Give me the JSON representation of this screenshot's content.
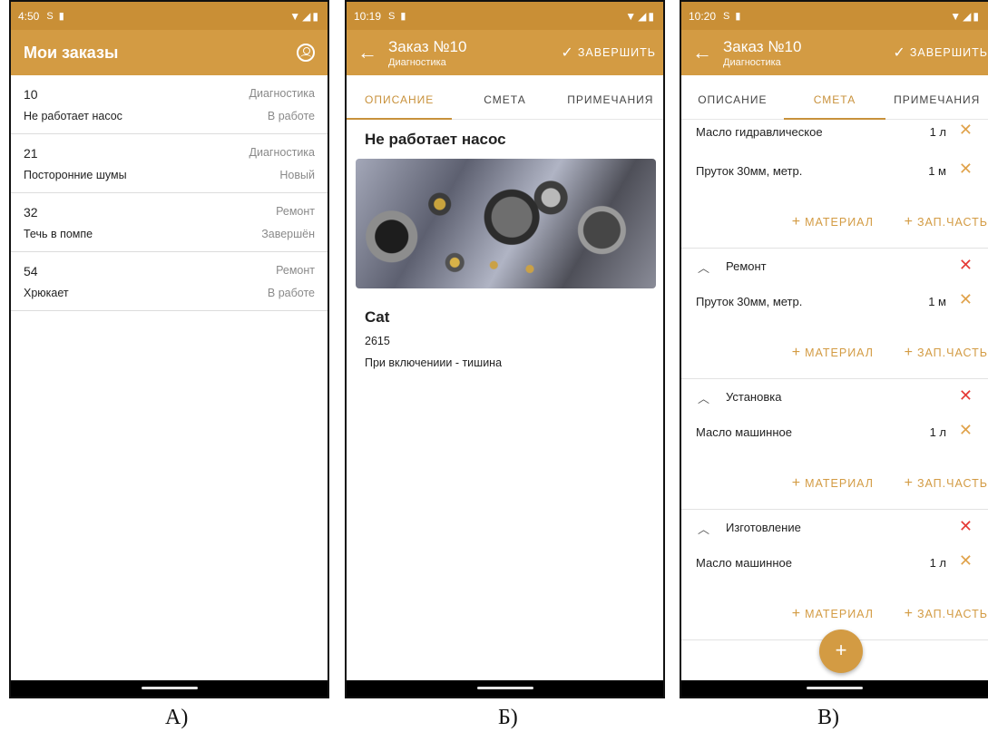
{
  "screenA": {
    "status_time": "4:50",
    "title": "Мои заказы",
    "orders": [
      {
        "number": "10",
        "type": "Диагностика",
        "description": "Не работает насос",
        "status": "В работе"
      },
      {
        "number": "21",
        "type": "Диагностика",
        "description": "Посторонние шумы",
        "status": "Новый"
      },
      {
        "number": "32",
        "type": "Ремонт",
        "description": "Течь в помпе",
        "status": "Завершён"
      },
      {
        "number": "54",
        "type": "Ремонт",
        "description": "Хрюкает",
        "status": "В работе"
      }
    ],
    "caption": "А)"
  },
  "screenB": {
    "status_time": "10:19",
    "title": "Заказ №10",
    "subtitle": "Диагностика",
    "finish_label": "ЗАВЕРШИТЬ",
    "tabs": [
      "ОПИСАНИЕ",
      "СМЕТА",
      "ПРИМЕЧАНИЯ"
    ],
    "active_tab": 0,
    "problem_title": "Не работает насос",
    "brand": "Cat",
    "code": "2615",
    "comment": "При включениии - тишина",
    "caption": "Б)"
  },
  "screenC": {
    "status_time": "10:20",
    "title": "Заказ №10",
    "subtitle": "Диагностика",
    "finish_label": "ЗАВЕРШИТЬ",
    "tabs": [
      "ОПИСАНИЕ",
      "СМЕТА",
      "ПРИМЕЧАНИЯ"
    ],
    "active_tab": 1,
    "add_material_label": "МАТЕРИАЛ",
    "add_part_label": "ЗАП.ЧАСТЬ",
    "first_items": [
      {
        "name": "Масло гидравлическое",
        "qty": "1 л"
      },
      {
        "name": "Пруток 30мм, метр.",
        "qty": "1 м"
      }
    ],
    "sections": [
      {
        "name": "Ремонт",
        "items": [
          {
            "name": "Пруток 30мм, метр.",
            "qty": "1 м"
          }
        ]
      },
      {
        "name": "Установка",
        "items": [
          {
            "name": "Масло машинное",
            "qty": "1 л"
          }
        ]
      },
      {
        "name": "Изготовление",
        "items": [
          {
            "name": "Масло машинное",
            "qty": "1 л"
          }
        ]
      }
    ],
    "caption": "В)"
  },
  "colors": {
    "accent": "#d39b43",
    "statusbar": "#c98f36",
    "delete_red": "#e53935"
  }
}
